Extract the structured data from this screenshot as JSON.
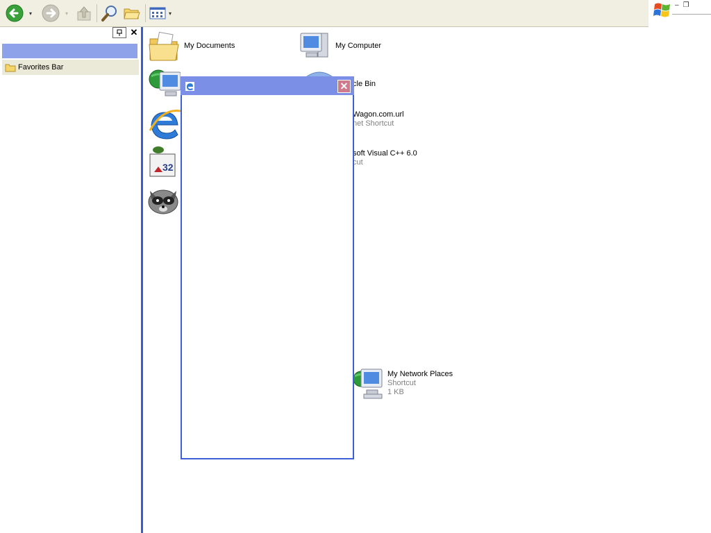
{
  "toolbar": {
    "back_icon": "back-arrow-icon",
    "forward_icon": "forward-arrow-icon",
    "up_icon": "folder-up-icon",
    "search_icon": "search-icon",
    "folders_icon": "folders-icon",
    "views_icon": "views-icon",
    "drop_glyph": "▾"
  },
  "window_controls": {
    "minimize": "–",
    "restore": "❐"
  },
  "left_pane": {
    "close_glyph": "✕",
    "favorites_bar_label": "Favorites Bar"
  },
  "desktop_items": [
    {
      "label": "My Documents",
      "icon": "my-documents-icon"
    },
    {
      "label": "My Computer",
      "icon": "my-computer-icon"
    },
    {
      "label": "cle Bin",
      "icon": "recycle-bin-icon"
    },
    {
      "label": "Wagon.com.url",
      "sub": "net Shortcut",
      "icon": "internet-shortcut-icon"
    },
    {
      "label": "soft Visual C++ 6.0",
      "sub": "cut",
      "icon": "visual-cpp-icon"
    },
    {
      "label": "My Network Places",
      "sub": "Shortcut",
      "sub2": "1 KB",
      "icon": "network-places-icon"
    }
  ],
  "dialog": {
    "close_glyph": "✕"
  },
  "colors": {
    "toolbar_bg": "#f1efe2",
    "pane_header": "#8da2e8",
    "splitter": "#3c5ad2",
    "dialog_title": "#7b8fe6",
    "dialog_border": "#3f5fd9",
    "dialog_close": "#d27a8d"
  }
}
